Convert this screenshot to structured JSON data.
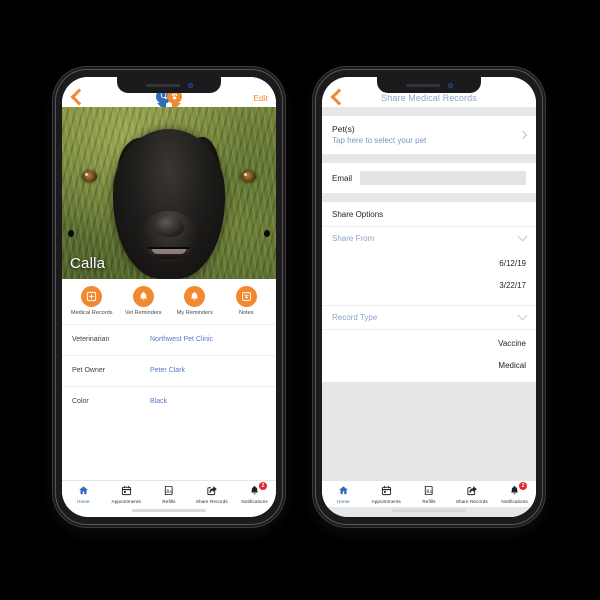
{
  "app": {
    "logo_blue_icon": "stethoscope-bubble-icon",
    "logo_orange_icon": "paw-bubble-icon"
  },
  "phone_left": {
    "navbar": {
      "back_icon": "back-chevron-icon",
      "edit_label": "Edit"
    },
    "hero": {
      "pet_name": "Calla",
      "image_alt": "black-labrador-dog-photo"
    },
    "quick_actions": [
      {
        "label": "Medical Records",
        "icon": "medical-records-icon"
      },
      {
        "label": "Vet Reminders",
        "icon": "bell-icon"
      },
      {
        "label": "My Reminders",
        "icon": "bell-icon"
      },
      {
        "label": "Notes",
        "icon": "notes-paw-icon"
      }
    ],
    "info_rows": [
      {
        "label": "Veterinarian",
        "value": "Northwest Pet Clinic"
      },
      {
        "label": "Pet Owner",
        "value": "Peter Clark"
      },
      {
        "label": "Color",
        "value": "Black"
      }
    ],
    "tabs": [
      {
        "label": "Home",
        "icon": "home-icon",
        "active": true
      },
      {
        "label": "Appointments",
        "icon": "calendar-icon",
        "active": false
      },
      {
        "label": "Refills",
        "icon": "prescription-icon",
        "active": false
      },
      {
        "label": "Share Records",
        "icon": "share-icon",
        "active": false
      },
      {
        "label": "Notifications",
        "icon": "bell-icon",
        "active": false,
        "badge": "2"
      }
    ]
  },
  "phone_right": {
    "navbar": {
      "back_icon": "back-chevron-icon",
      "title": "Share Medical Records"
    },
    "pets_section": {
      "title": "Pet(s)",
      "subtitle": "Tap here to select your pet",
      "chevron_icon": "chevron-right-icon"
    },
    "email_section": {
      "label": "Email",
      "value": "",
      "placeholder": ""
    },
    "share_options": {
      "heading": "Share Options",
      "share_from": {
        "label": "Share From",
        "chevron_icon": "chevron-down-icon"
      },
      "dates": [
        "6/12/19",
        "3/22/17"
      ],
      "record_type": {
        "label": "Record Type",
        "chevron_icon": "chevron-down-icon"
      },
      "record_types": [
        "Vaccine",
        "Medical"
      ]
    },
    "tabs": [
      {
        "label": "Home",
        "icon": "home-icon",
        "active": true
      },
      {
        "label": "Appointments",
        "icon": "calendar-icon",
        "active": false
      },
      {
        "label": "Refills",
        "icon": "prescription-icon",
        "active": false
      },
      {
        "label": "Share Records",
        "icon": "share-icon",
        "active": false
      },
      {
        "label": "Notifications",
        "icon": "bell-icon",
        "active": false,
        "badge": "2"
      }
    ]
  },
  "colors": {
    "accent_orange": "#f2892f",
    "accent_blue": "#2f6cb5",
    "link_blue": "#5b78c4",
    "badge_red": "#e8262c",
    "page_background": "#000000",
    "form_background": "#e6e7e9"
  }
}
